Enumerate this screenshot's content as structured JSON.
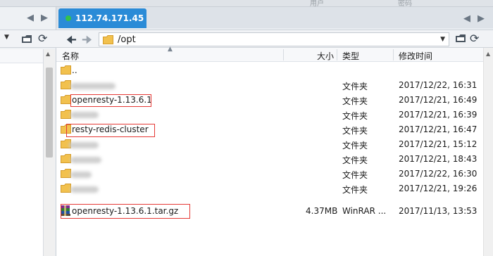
{
  "top_strip": {
    "fragment_1": "用户",
    "fragment_2": "密码"
  },
  "session_tab": {
    "label": "112.74.171.45",
    "status_color": "#34c24a",
    "tab_color": "#2a8bd7"
  },
  "nav": {
    "prev_icon": "chevron-left-icon",
    "next_icon": "chevron-right-icon"
  },
  "toolbar": {
    "back_icon": "arrow-left-icon",
    "forward_icon": "arrow-right-icon",
    "path": "/opt",
    "new_folder_icon": "folder-icon",
    "refresh_icon": "refresh-icon"
  },
  "columns": {
    "name": "名称",
    "size": "大小",
    "type": "类型",
    "mtime": "修改时间"
  },
  "rows": [
    {
      "name": "..",
      "size": "",
      "type": "",
      "mtime": "",
      "icon": "folder-icon"
    },
    {
      "name": "",
      "size": "",
      "type": "文件夹",
      "mtime": "2017/12/22, 16:31",
      "icon": "folder-icon"
    },
    {
      "name": "openresty-1.13.6.1",
      "size": "",
      "type": "文件夹",
      "mtime": "2017/12/21, 16:49",
      "icon": "folder-icon"
    },
    {
      "name": "",
      "size": "",
      "type": "文件夹",
      "mtime": "2017/12/21, 16:39",
      "icon": "folder-icon"
    },
    {
      "name": "resty-redis-cluster",
      "size": "",
      "type": "文件夹",
      "mtime": "2017/12/21, 16:47",
      "icon": "folder-icon"
    },
    {
      "name": "",
      "size": "",
      "type": "文件夹",
      "mtime": "2017/12/21, 15:12",
      "icon": "folder-icon"
    },
    {
      "name": "",
      "size": "",
      "type": "文件夹",
      "mtime": "2017/12/21, 18:43",
      "icon": "folder-icon"
    },
    {
      "name": "",
      "size": "",
      "type": "文件夹",
      "mtime": "2017/12/22, 16:30",
      "icon": "folder-icon"
    },
    {
      "name": "",
      "size": "",
      "type": "文件夹",
      "mtime": "2017/12/21, 19:26",
      "icon": "folder-icon"
    },
    {
      "name": "openresty-1.13.6.1.tar.gz",
      "size": "4.37MB",
      "type": "WinRAR ...",
      "mtime": "2017/11/13, 13:53",
      "icon": "winrar-archive-icon"
    }
  ]
}
